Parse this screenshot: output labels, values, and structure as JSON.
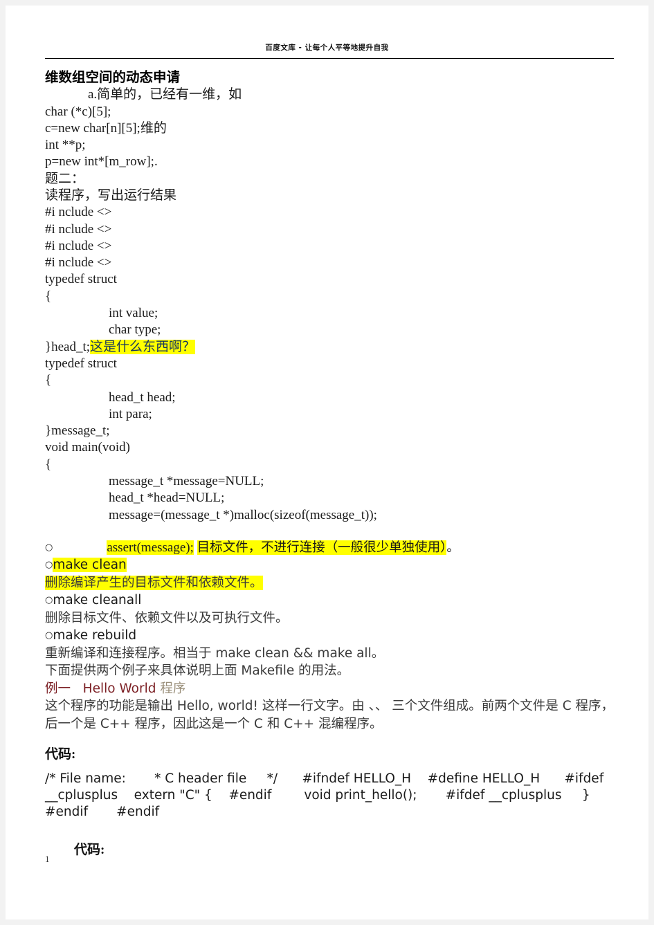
{
  "header": {
    "site_text": "百度文库 - 让每个人平等地提升自我"
  },
  "document": {
    "title": "维数组空间的动态申请",
    "intro_line": "a.简单的，已经有一维，如",
    "code_lines_1": [
      "char (*c)[5];",
      "c=new char[n][5];维的",
      "int **p;",
      "p=new int*[m_row];."
    ],
    "question_label": "题二：",
    "question_text": "读程序，写出运行结果",
    "includes": [
      "#i nclude <>",
      "#i nclude <>",
      "#i nclude <>",
      "#i nclude <>"
    ],
    "struct1": {
      "typedef": "typedef struct",
      "open_brace": "{",
      "fields": [
        "int value;",
        "char type;"
      ],
      "close": "}head_t;",
      "close_comment": "这是什么东西啊？"
    },
    "struct2": {
      "typedef": "typedef struct",
      "open_brace": "{",
      "fields": [
        "head_t head;",
        "int para;"
      ],
      "close": "}message_t;"
    },
    "main": {
      "signature": "void main(void)",
      "open_brace": "{",
      "body": [
        "message_t *message=NULL;",
        "head_t *head=NULL;",
        "message=(message_t *)malloc(sizeof(message_t));"
      ]
    },
    "assert_line": {
      "bullet": "○",
      "code": "assert(message);",
      "comment_highlight": "目标文件，不进行连接（一般很少单独使用）",
      "comment_tail": "。"
    },
    "make_targets": [
      {
        "bullet": "○",
        "name": "make clean",
        "highlight_name": true,
        "description": "删除编译产生的目标文件和依赖文件。",
        "highlight_description": true
      },
      {
        "bullet": "○",
        "name": "make cleanall",
        "highlight_name": false,
        "description": "删除目标文件、依赖文件以及可执行文件。",
        "highlight_description": false
      },
      {
        "bullet": "○",
        "name": "make rebuild",
        "highlight_name": false,
        "description": "重新编译和连接程序。相当于 make clean && make all。",
        "highlight_description": false
      }
    ],
    "makefile_note": "下面提供两个例子来具体说明上面 Makefile 的用法。",
    "example_heading": {
      "label": "例一",
      "name": "Hello World",
      "suffix": "程序"
    },
    "example_description": "这个程序的功能是输出 Hello, world! 这样一行文字。由 、、 三个文件组成。前两个文件是 C 程序，后一个是 C++ 程序，因此这是一个 C 和 C++ 混编程序。",
    "code_heading_1": "代码:",
    "code_block_1": "/* File name:       * C header file     */      #ifndef HELLO_H    #define HELLO_H      #ifdef __cplusplus    extern \"C\" {    #endif        void print_hello();       #ifdef __cplusplus     }    #endif       #endif",
    "code_heading_2": "代码:",
    "page_number": "1"
  },
  "colors": {
    "highlight": "#ffff00",
    "comment_blue": "#17365d",
    "heading_maroon": "#7b1e23",
    "body_gray": "#3a3a3a"
  }
}
